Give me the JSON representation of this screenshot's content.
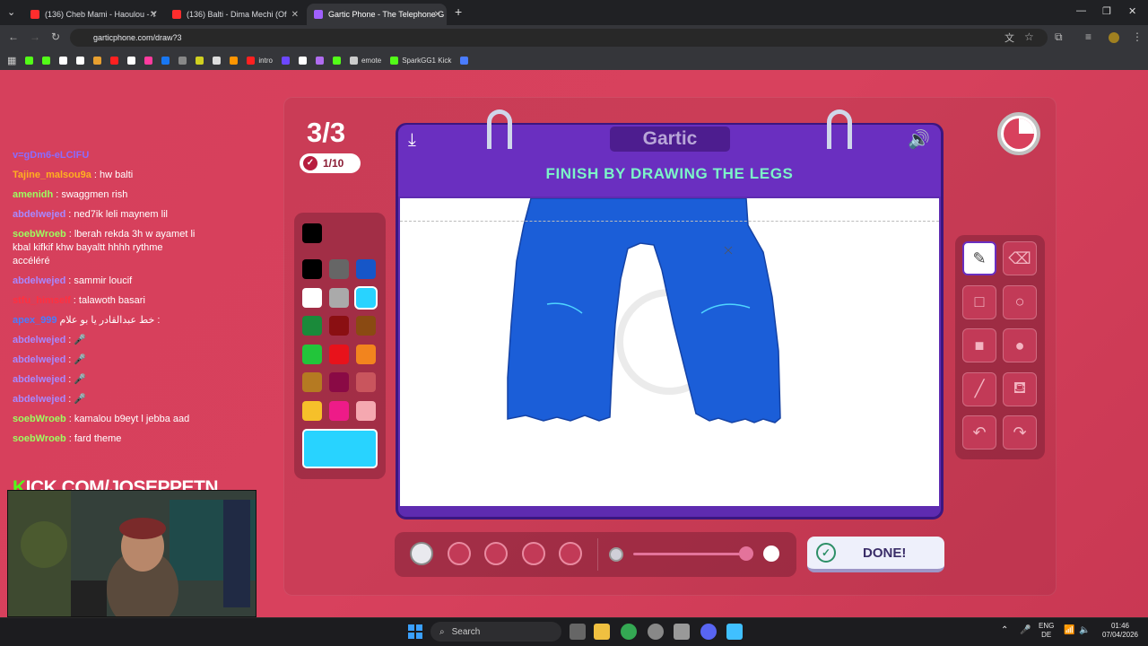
{
  "browser": {
    "tabs": [
      {
        "title": "(136) Cheb Mami - Haoulou - Y",
        "color": "#ff2d2d"
      },
      {
        "title": "(136) Balti - Dima Mechi (Of",
        "color": "#ff2d2d"
      },
      {
        "title": "Gartic Phone - The Telephone G",
        "color": "#a060ff"
      }
    ],
    "url": "garticphone.com/draw?3",
    "bookmarks": [
      {
        "label": "",
        "color": "#53fc18"
      },
      {
        "label": "",
        "color": "#53fc18"
      },
      {
        "label": "",
        "color": "#ffffff"
      },
      {
        "label": "",
        "color": "#ffffff"
      },
      {
        "label": "",
        "color": "#e8a030"
      },
      {
        "label": "",
        "color": "#ff2020"
      },
      {
        "label": "",
        "color": "#ffffff"
      },
      {
        "label": "",
        "color": "#ff3b9e"
      },
      {
        "label": "",
        "color": "#1877f2"
      },
      {
        "label": "",
        "color": "#888888"
      },
      {
        "label": "",
        "color": "#d0d020"
      },
      {
        "label": "",
        "color": "#dddddd"
      },
      {
        "label": "",
        "color": "#ff9500"
      },
      {
        "label": "intro",
        "color": "#ff2020"
      },
      {
        "label": "",
        "color": "#6c47ff"
      },
      {
        "label": "",
        "color": "#ffffff"
      },
      {
        "label": "",
        "color": "#b06cf0"
      },
      {
        "label": "",
        "color": "#53fc18"
      },
      {
        "label": "emote",
        "color": "#cccccc"
      },
      {
        "label": "SparkGG1 Kick",
        "color": "#53fc18"
      },
      {
        "label": "",
        "color": "#4a7cff"
      }
    ]
  },
  "chat": [
    {
      "user": "v=gDm6-eLClFU",
      "msg": "",
      "color": "#8a6cff"
    },
    {
      "user": "Tajine_malsou9a",
      "msg": ": hw balti",
      "color": "#ffb020"
    },
    {
      "user": "amenidh",
      "msg": ": swaggmen rish",
      "color": "#9dff60"
    },
    {
      "user": "abdelwejed",
      "msg": ": ned7ik leli maynem lil",
      "color": "#a888ff"
    },
    {
      "user": "soebWroeb",
      "msg": ": lberah rekda 3h w ayamet li kbal kifkif khw bayaltt hhhh rythme accéléré",
      "color": "#9dff60"
    },
    {
      "user": "abdelwejed",
      "msg": ": sammir loucif",
      "color": "#a888ff"
    },
    {
      "user": "stfu_himself",
      "msg": ": talawoth basari",
      "color": "#ff3040"
    },
    {
      "user": "apex_999",
      "msg": "خط عبدالقادر يا بو علام :",
      "color": "#4a7cff"
    },
    {
      "user": "abdelwejed",
      "msg": ": 🎤",
      "color": "#a888ff"
    },
    {
      "user": "abdelwejed",
      "msg": ": 🎤",
      "color": "#a888ff"
    },
    {
      "user": "abdelwejed",
      "msg": ": 🎤",
      "color": "#a888ff"
    },
    {
      "user": "abdelwejed",
      "msg": ": 🎤",
      "color": "#a888ff"
    },
    {
      "user": "soebWroeb",
      "msg": ": kamalou b9eyt l jebba aad",
      "color": "#9dff60"
    },
    {
      "user": "soebWroeb",
      "msg": ": fard theme",
      "color": "#9dff60"
    }
  ],
  "overlay": {
    "kick_prefix": "K",
    "kick_text": "ICK.COM/JOSEPPETN"
  },
  "game": {
    "round": "3/3",
    "progress": "1/10",
    "logo": "Gartic",
    "instruction": "FINISH BY DRAWING THE LEGS",
    "done_label": "DONE!",
    "selected_color": "#28d3ff",
    "palette": [
      "#000000",
      "#666666",
      "#1656c8",
      "#ffffff",
      "#aaaaaa",
      "#28d3ff",
      "#1a8a3a",
      "#8a0f12",
      "#8a4a12",
      "#22c53a",
      "#e8121b",
      "#f2841e",
      "#b57a22",
      "#8a0a45",
      "#c9555d",
      "#f6c02a",
      "#ee1b88",
      "#f5a8b0"
    ],
    "first_swatch": "#000000",
    "brush_sizes": 5,
    "opacity": 0.5,
    "tools": [
      "pencil-icon",
      "eraser-icon",
      "square-outline-icon",
      "circle-outline-icon",
      "square-fill-icon",
      "circle-fill-icon",
      "line-icon",
      "bucket-icon",
      "undo-icon",
      "redo-icon"
    ],
    "drawing_color": "#1b5ed8"
  },
  "taskbar": {
    "search_label": "Search",
    "lang1": "ENG",
    "lang2": "DE",
    "time": "01:46",
    "date": "07/04/2026"
  }
}
